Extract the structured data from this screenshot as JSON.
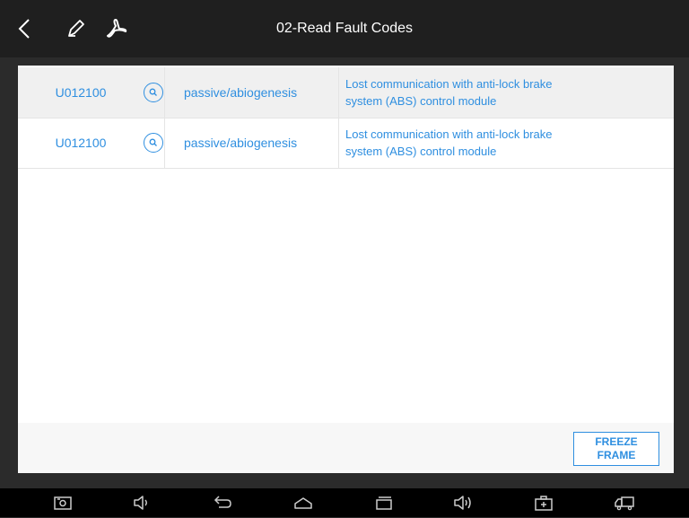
{
  "header": {
    "title": "02-Read Fault Codes",
    "icons": [
      "back-icon",
      "edit-icon",
      "pdf-icon"
    ]
  },
  "fault_list": [
    {
      "code": "U012100",
      "status": "passive/abiogenesis",
      "description_line1": "Lost communication with anti-lock brake",
      "description_line2": "system (ABS) control module",
      "selected": true
    },
    {
      "code": "U012100",
      "status": "passive/abiogenesis",
      "description_line1": "Lost communication with anti-lock brake",
      "description_line2": "system (ABS) control module",
      "selected": false
    }
  ],
  "footer": {
    "freeze_line1": "FREEZE",
    "freeze_line2": "FRAME"
  },
  "nav_icons": [
    "screenshot-icon",
    "volume-down-icon",
    "back-arrow-icon",
    "home-icon",
    "recent-apps-icon",
    "volume-up-icon",
    "toolbox-icon",
    "truck-icon"
  ],
  "colors": {
    "accent": "#2f8fe0",
    "topbar": "#1f1f1f",
    "navbar": "#000000",
    "selected_row": "#f0f0f0"
  }
}
